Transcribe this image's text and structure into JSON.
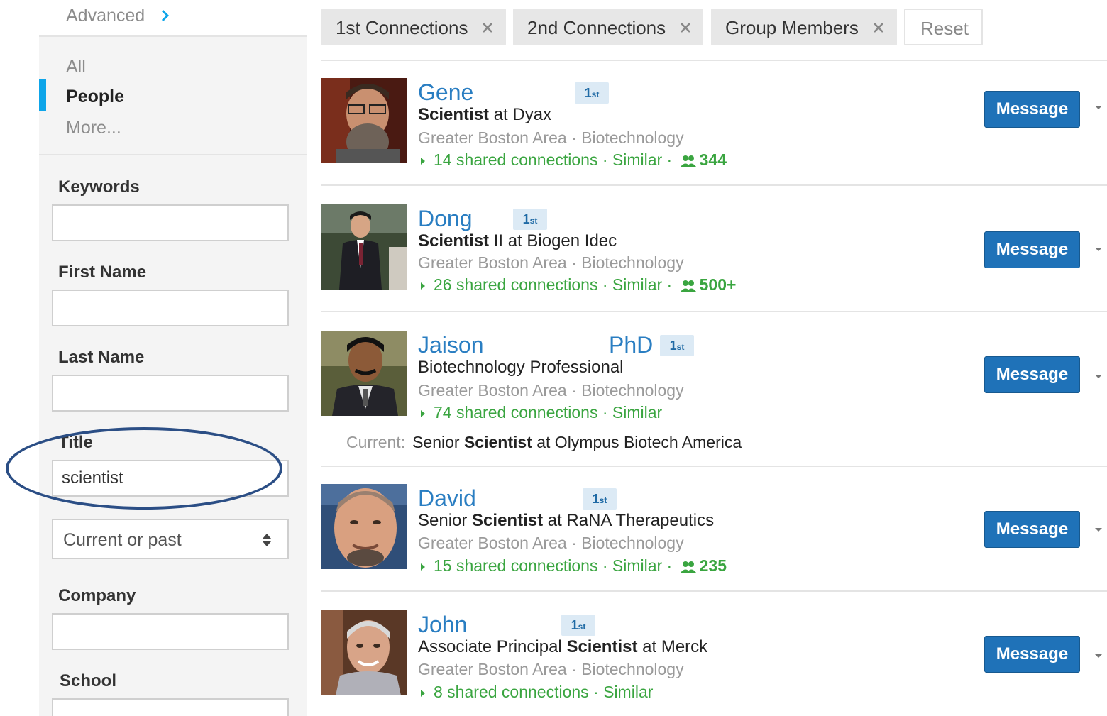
{
  "sidebar": {
    "advanced_label": "Advanced",
    "nav": {
      "all": "All",
      "people": "People",
      "more": "More..."
    },
    "fields": {
      "keywords_label": "Keywords",
      "keywords_value": "",
      "first_name_label": "First Name",
      "first_name_value": "",
      "last_name_label": "Last Name",
      "last_name_value": "",
      "title_label": "Title",
      "title_value": "scientist",
      "title_scope": "Current or past",
      "company_label": "Company",
      "company_value": "",
      "school_label": "School",
      "school_value": ""
    },
    "accent_color": "#0ea5e9",
    "annotation_color": "#2b4e85"
  },
  "filters": {
    "chips": [
      "1st Connections",
      "2nd Connections",
      "Group Members"
    ],
    "reset_label": "Reset"
  },
  "results": [
    {
      "name": "Gene",
      "degree": "1",
      "degree_suffix": "st",
      "headline_bold": "Scientist",
      "headline_rest": " at Dyax",
      "location": "Greater Boston Area · Biotechnology",
      "shared": "14 shared connections",
      "similar": "Similar",
      "groups": "344",
      "message_label": "Message"
    },
    {
      "name": "Dong",
      "degree": "1",
      "degree_suffix": "st",
      "headline_bold": "Scientist",
      "headline_rest": " II at Biogen Idec",
      "location": "Greater Boston Area · Biotechnology",
      "shared": "26 shared connections",
      "similar": "Similar",
      "groups": "500+",
      "message_label": "Message"
    },
    {
      "name": "Jaison",
      "name_suffix": "PhD",
      "degree": "1",
      "degree_suffix": "st",
      "headline": "Biotechnology Professional",
      "location": "Greater Boston Area · Biotechnology",
      "shared": "74 shared connections",
      "similar": "Similar",
      "current_label": "Current:",
      "current_pre": "Senior ",
      "current_bold": "Scientist",
      "current_post": " at Olympus Biotech America",
      "message_label": "Message"
    },
    {
      "name": "David",
      "degree": "1",
      "degree_suffix": "st",
      "headline_pre": "Senior ",
      "headline_bold": "Scientist",
      "headline_rest": " at RaNA Therapeutics",
      "location": "Greater Boston Area · Biotechnology",
      "shared": "15 shared connections",
      "similar": "Similar",
      "groups": "235",
      "message_label": "Message"
    },
    {
      "name": "John",
      "degree": "1",
      "degree_suffix": "st",
      "headline_pre": "Associate Principal ",
      "headline_bold": "Scientist",
      "headline_rest": " at Merck",
      "location": "Greater Boston Area · Biotechnology",
      "shared": "8 shared connections",
      "similar": "Similar",
      "message_label": "Message"
    }
  ],
  "colors": {
    "link": "#2a7ec2",
    "green": "#3aa540",
    "button": "#1f72b8"
  }
}
